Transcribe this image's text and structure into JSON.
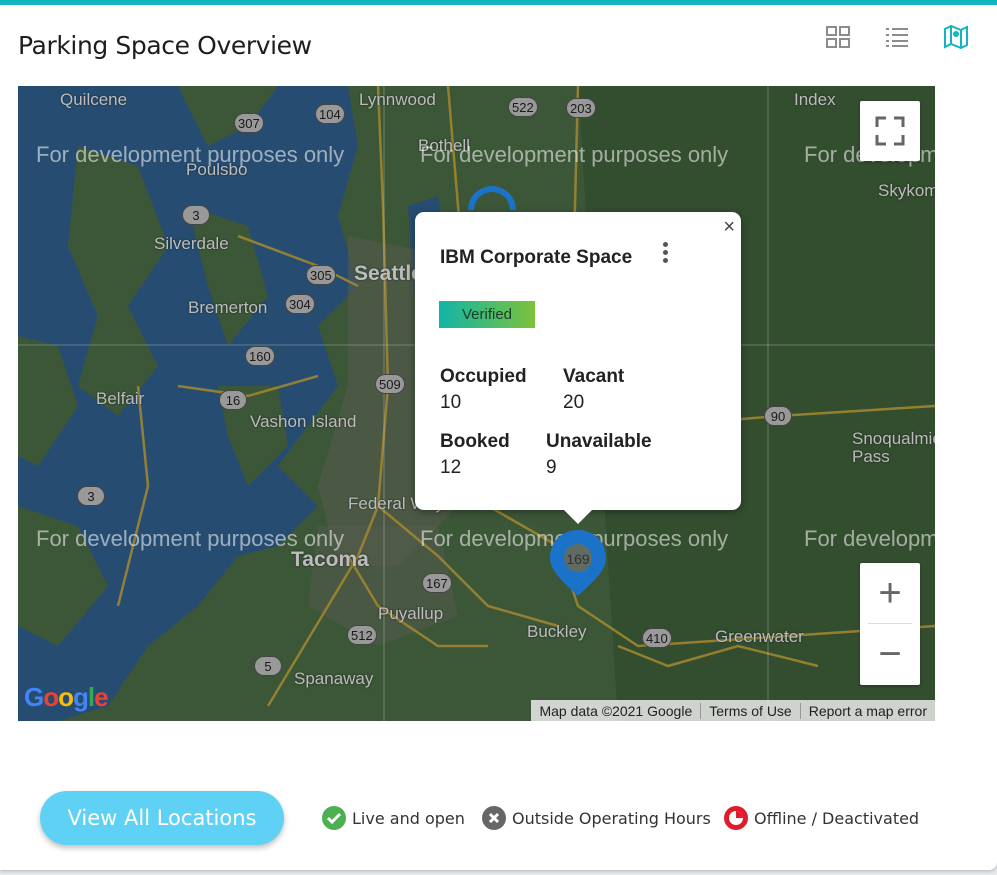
{
  "header": {
    "title": "Parking Space Overview"
  },
  "view_toggles": [
    {
      "name": "grid-view-icon"
    },
    {
      "name": "list-view-icon"
    },
    {
      "name": "map-view-icon",
      "active": true
    }
  ],
  "colors": {
    "accent": "#12b5c0",
    "button": "#5ed1f4",
    "live": "#4caf50",
    "outside": "#666666",
    "offline": "#e01b2c"
  },
  "map": {
    "watermark": "For development purposes only",
    "places": [
      "Quilcene",
      "Lynnwood",
      "Index",
      "Poulsbo",
      "Bothell",
      "Skykomish",
      "Silverdale",
      "Seattle",
      "Bremerton",
      "Belfair",
      "Vashon Island",
      "Federal Way",
      "Tacoma",
      "Puyallup",
      "Buckley",
      "Greenwater",
      "Spanaway",
      "Snoqualmie Pass"
    ],
    "routes": [
      "307",
      "104",
      "522",
      "203",
      "3",
      "305",
      "304",
      "160",
      "509",
      "16",
      "90",
      "3",
      "167",
      "169",
      "512",
      "410",
      "5"
    ],
    "attribution": {
      "data": "Map data ©2021 Google",
      "terms": "Terms of Use",
      "report": "Report a map error"
    },
    "logo": "Google"
  },
  "popup": {
    "title": "IBM Corporate Space",
    "badge": "Verified",
    "occupied_label": "Occupied",
    "occupied": "10",
    "vacant_label": "Vacant",
    "vacant": "20",
    "booked_label": "Booked",
    "booked": "12",
    "unavailable_label": "Unavailable",
    "unavailable": "9",
    "close": "×"
  },
  "footer": {
    "view_all": "View All Locations",
    "legend": [
      {
        "label": "Live and open",
        "icon": "check-circle-icon"
      },
      {
        "label": "Outside Operating Hours",
        "icon": "x-circle-icon"
      },
      {
        "label": "Offline / Deactivated",
        "icon": "clock-icon"
      }
    ]
  }
}
